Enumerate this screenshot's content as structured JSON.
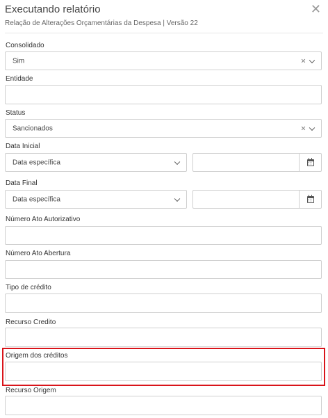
{
  "header": {
    "title": "Executando relatório",
    "subtitle": "Relação de Alterações Orçamentárias da Despesa | Versão 22",
    "close_icon": "close-icon"
  },
  "fields": {
    "consolidado": {
      "label": "Consolidado",
      "value": "Sim",
      "clear": "×"
    },
    "entidade": {
      "label": "Entidade",
      "value": ""
    },
    "status": {
      "label": "Status",
      "value": "Sancionados",
      "clear": "×"
    },
    "data_inicial": {
      "label": "Data Inicial",
      "mode": "Data específica",
      "date": ""
    },
    "data_final": {
      "label": "Data Final",
      "mode": "Data específica",
      "date": ""
    },
    "numero_ato_autorizativo": {
      "label": "Número Ato Autorizativo",
      "value": ""
    },
    "numero_ato_abertura": {
      "label": "Número Ato Abertura",
      "value": ""
    },
    "tipo_credito": {
      "label": "Tipo de crédito",
      "value": ""
    },
    "recurso_credito": {
      "label": "Recurso Credito",
      "value": ""
    },
    "origem_creditos": {
      "label": "Origem dos créditos",
      "value": "",
      "highlighted": true
    },
    "recurso_origem": {
      "label": "Recurso Origem",
      "value": ""
    }
  },
  "colors": {
    "highlight": "#d9141a",
    "border": "#cfcfcf"
  }
}
